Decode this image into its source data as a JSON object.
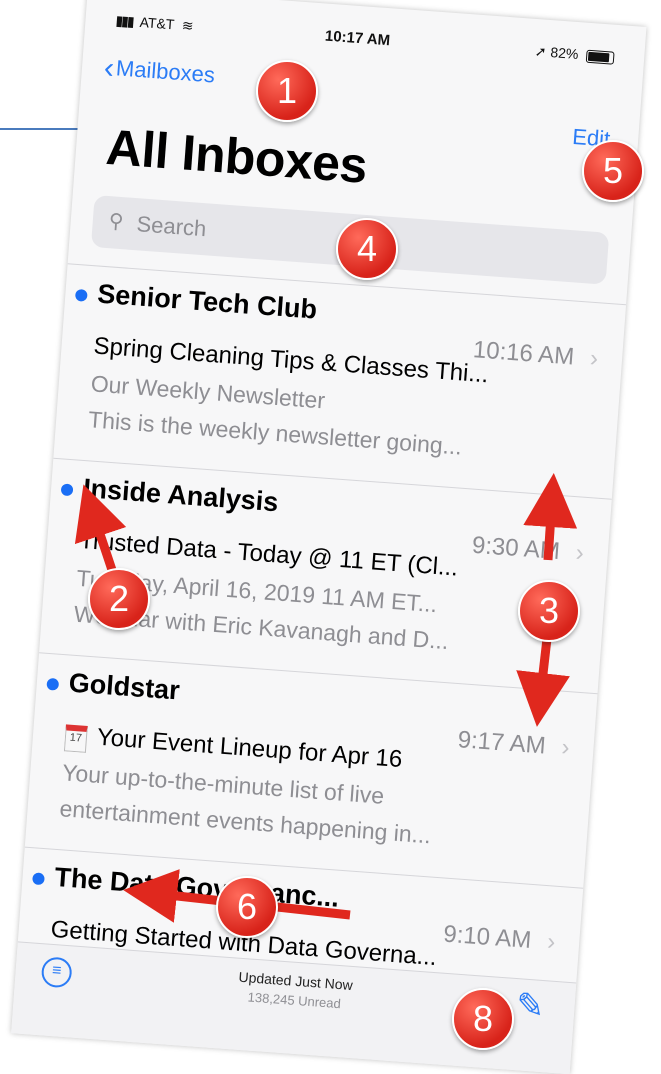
{
  "status_bar": {
    "carrier": "AT&T",
    "time": "10:17 AM",
    "battery": "82%"
  },
  "nav": {
    "back_label": "Mailboxes",
    "edit_label": "Edit",
    "title": "All Inboxes"
  },
  "search": {
    "placeholder": "Search"
  },
  "messages": [
    {
      "sender": "Senior Tech Club",
      "time": "10:16 AM",
      "subject": "Spring Cleaning Tips & Classes Thi...",
      "preview1": "Our Weekly Newsletter",
      "preview2": "This is the weekly newsletter going..."
    },
    {
      "sender": "Inside Analysis",
      "time": "9:30 AM",
      "subject": "Trusted Data - Today @ 11 ET (Cl...",
      "preview1": "Tuesday, April 16, 2019 11 AM ET...",
      "preview2": "Webinar with Eric Kavanagh and D..."
    },
    {
      "sender": "Goldstar",
      "time": "9:17 AM",
      "subject": "Your Event Lineup for Apr 16",
      "preview1": "Your up-to-the-minute list of live",
      "preview2": "entertainment events happening in..."
    },
    {
      "sender": "The Data Governanc...",
      "time": "9:10 AM",
      "subject": "Getting Started with Data Governa...",
      "preview1": "",
      "preview2": ""
    }
  ],
  "toolbar": {
    "updated": "Updated Just Now",
    "unread": "138,245 Unread"
  },
  "annotations": [
    "1",
    "2",
    "3",
    "4",
    "5",
    "6",
    "8"
  ],
  "colors": {
    "accent": "#2b7cf6",
    "unread_dot": "#1a6ef5",
    "annotation": "#e0281e"
  }
}
